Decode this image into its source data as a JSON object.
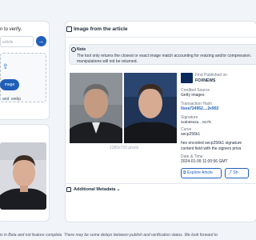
{
  "left": {
    "verify_text": "n to verify.",
    "url_placeholder": "article",
    "go_icon": "arrow-right-icon",
    "upload_glyph": "⇧",
    "image_button": "mage",
    "formats": "and .webp"
  },
  "panel": {
    "title": "Image from the article",
    "note_title": "Note",
    "note_line1": "The tool only returns the closest or exact image match accounting for resizing and/or compression.",
    "note_line2": "manipulations will not be returned.",
    "dimensions": "1280x720 pixels"
  },
  "meta": {
    "first_published_label": "First Published on",
    "publisher": "FOXNEWS",
    "credited_source_label": "Credited Source",
    "credited_source": "Getty images",
    "transaction_hash_label": "Transaction Hash",
    "transaction_hash": "0xea724952....2e902",
    "signature_label": "Signature",
    "signature": "0x6b6942a....817fc",
    "curve_label": "Curve",
    "curve": "secp256k1",
    "hex_note_line1": "hex encoded secp256k1 signature",
    "hex_note_line2": "content field with the signers priva",
    "date_label": "Date & Time",
    "date": "2024-01-09 11:00:56 GMT",
    "explore_button": "Explore Article",
    "share_button": "Sh"
  },
  "additional_metadata": "Additional Metadata",
  "footer": "is in Beta and not feature complete. There may be some delays between publish and verification status. We look forward to",
  "colors": {
    "accent": "#1f5fb8",
    "panel_bg": "#ffffff",
    "page_bg": "#f1f4f8"
  }
}
